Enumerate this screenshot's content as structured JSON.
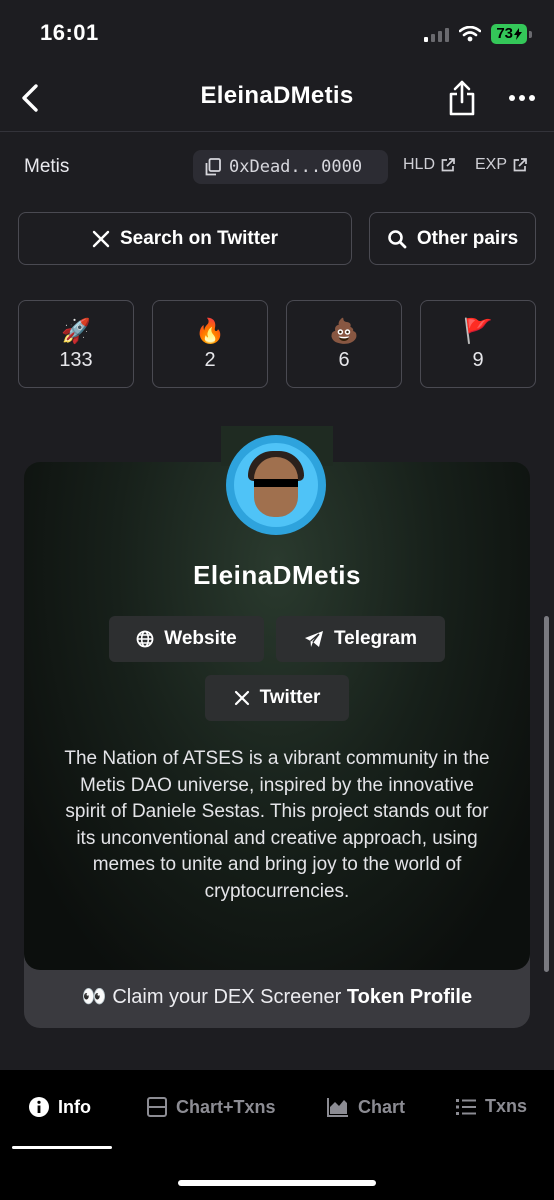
{
  "status": {
    "time": "16:01",
    "battery": "73"
  },
  "nav": {
    "title": "EleinaDMetis"
  },
  "chain": {
    "name": "Metis",
    "address": "0xDead...0000",
    "links": [
      {
        "label": "HLD"
      },
      {
        "label": "EXP"
      }
    ]
  },
  "actions": {
    "search_twitter": "Search on Twitter",
    "other_pairs": "Other pairs"
  },
  "reactions": [
    {
      "icon": "rocket-icon",
      "emoji": "🚀",
      "count": "133"
    },
    {
      "icon": "fire-icon",
      "emoji": "🔥",
      "count": "2"
    },
    {
      "icon": "poop-icon",
      "emoji": "💩",
      "count": "6"
    },
    {
      "icon": "red-flag-icon",
      "emoji": "🚩",
      "count": "9"
    }
  ],
  "profile": {
    "name": "EleinaDMetis",
    "links": {
      "website": "Website",
      "telegram": "Telegram",
      "twitter": "Twitter"
    },
    "description": "The Nation of ATSES is a vibrant community in the Metis DAO universe, inspired by the innovative spirit of Daniele Sestas. This project stands out for its unconventional and creative approach, using memes to unite and bring joy to the world of cryptocurrencies.",
    "claim": {
      "emoji": "👀",
      "prefix": "Claim your DEX Screener",
      "bold": "Token Profile"
    }
  },
  "tabs": [
    {
      "label": "Info",
      "active": true
    },
    {
      "label": "Chart+Txns"
    },
    {
      "label": "Chart"
    },
    {
      "label": "Txns"
    }
  ],
  "colors": {
    "background": "#1d1d21",
    "battery": "#34c759",
    "tabbar": "#000000",
    "avatar": "#2ea3dd"
  }
}
